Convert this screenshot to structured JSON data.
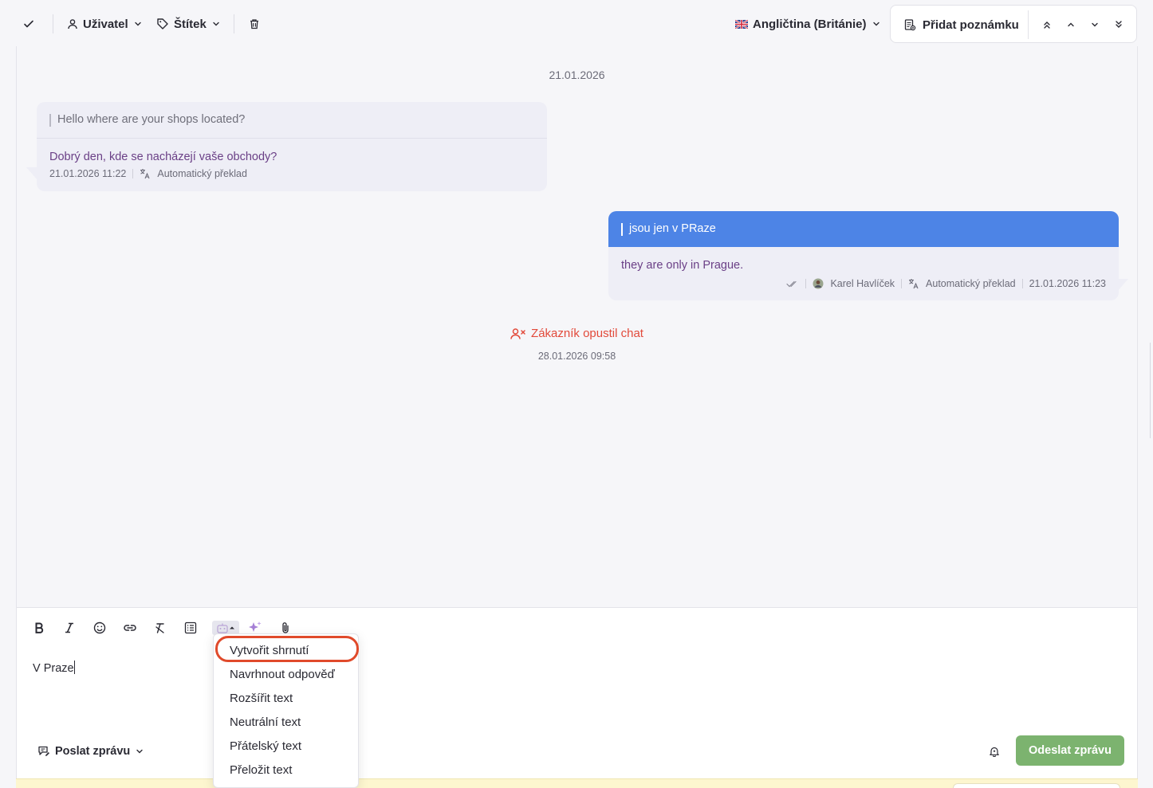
{
  "toolbar": {
    "user_label": "Uživatel",
    "tag_label": "Štítek",
    "language_label": "Angličtina (Británie)",
    "add_note_label": "Přidat poznámku"
  },
  "chat": {
    "date_separator": "21.01.2026",
    "incoming": {
      "original": "Hello where are your shops located?",
      "translated": "Dobrý den, kde se nacházejí vaše obchody?",
      "timestamp": "21.01.2026 11:22",
      "translation_label": "Automatický překlad"
    },
    "outgoing": {
      "original": "jsou jen v PRaze",
      "translated": "they are only in Prague.",
      "agent": "Karel Havlíček",
      "translation_label": "Automatický překlad",
      "timestamp": "21.01.2026 11:23"
    },
    "system_event": {
      "text": "Zákazník opustil chat",
      "timestamp": "28.01.2026 09:58"
    }
  },
  "composer": {
    "text": "V Praze",
    "send_mode_label": "Poslat zprávu",
    "send_button_label": "Odeslat zprávu"
  },
  "ai_menu": {
    "items": [
      "Vytvořit shrnutí",
      "Navrhnout odpověď",
      "Rozšířit text",
      "Neutrální text",
      "Přátelský text",
      "Přeložit text"
    ]
  },
  "colors": {
    "accent_blue": "#4d84e6",
    "send_green": "#7cb36f",
    "alert_red": "#e24a3b",
    "translated_purple": "#6a3f86",
    "highlight_ring": "#e04a2b"
  }
}
